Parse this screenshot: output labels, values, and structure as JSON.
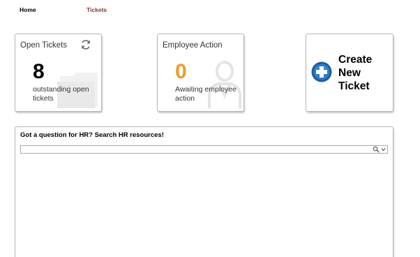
{
  "nav": {
    "items": [
      {
        "label": "Home"
      },
      {
        "label": "Tickets"
      }
    ]
  },
  "cards": {
    "open_tickets": {
      "title": "Open Tickets",
      "count": "8",
      "description": "outstanding open tickets",
      "icon": "refresh-icon",
      "background_icon": "folder-icon"
    },
    "employee_action": {
      "title": "Employee Action",
      "count": "0",
      "description": "Awaiting employee action",
      "background_icon": "person-icon",
      "count_color": "#f29a2e"
    },
    "create_ticket": {
      "label": "Create New Ticket",
      "icon": "plus-circle-icon",
      "icon_color": "#1c5e9e"
    }
  },
  "search": {
    "title": "Got a question for HR? Search HR resources!",
    "value": "",
    "placeholder": "",
    "icon": "search-icon",
    "dropdown_icon": "chevron-down-icon"
  },
  "colors": {
    "nav_active": "#7a3b2e",
    "card_border": "#b5b5b5"
  }
}
